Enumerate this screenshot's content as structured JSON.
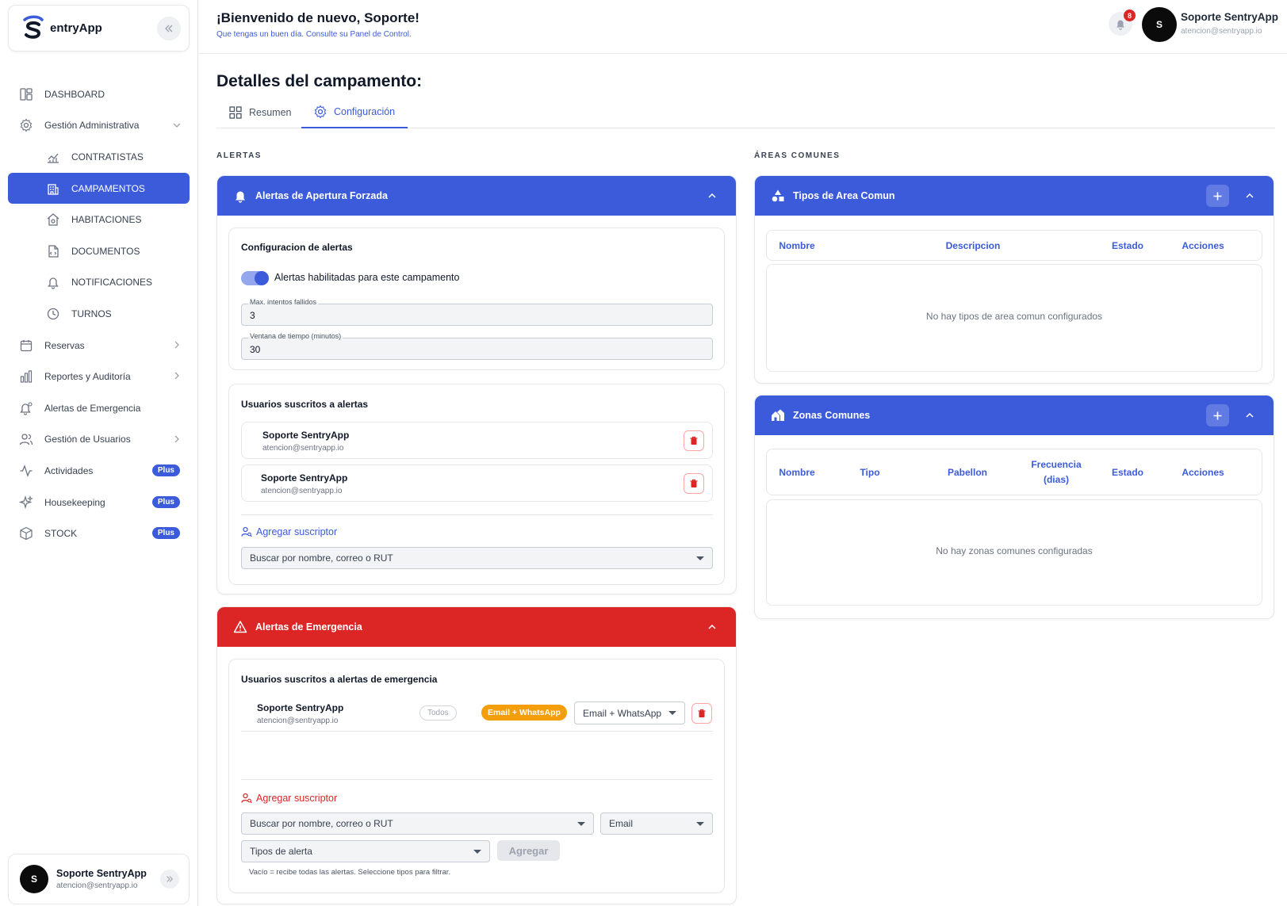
{
  "brand": {
    "logo_letter": "S",
    "name": "entryApp"
  },
  "sidebar": {
    "items": [
      {
        "label": "DASHBOARD"
      },
      {
        "label": "Gestión Administrativa"
      },
      {
        "label": "CONTRATISTAS"
      },
      {
        "label": "CAMPAMENTOS"
      },
      {
        "label": "HABITACIONES"
      },
      {
        "label": "DOCUMENTOS"
      },
      {
        "label": "NOTIFICACIONES"
      },
      {
        "label": "TURNOS"
      },
      {
        "label": "Reservas"
      },
      {
        "label": "Reportes y Auditoría"
      },
      {
        "label": "Alertas de Emergencia"
      },
      {
        "label": "Gestión de Usuarios"
      },
      {
        "label": "Actividades",
        "badge": "Plus"
      },
      {
        "label": "Housekeeping",
        "badge": "Plus"
      },
      {
        "label": "STOCK",
        "badge": "Plus"
      }
    ],
    "user": {
      "initial": "S",
      "name": "Soporte SentryApp",
      "email": "atencion@sentryapp.io"
    }
  },
  "header": {
    "welcome": "¡Bienvenido de nuevo, Soporte!",
    "subtitle": "Que tengas un buen día. Consulte su Panel de Control.",
    "notification_count": "8",
    "user": {
      "initial": "S",
      "name": "Soporte SentryApp",
      "email": "atencion@sentryapp.io"
    }
  },
  "page": {
    "title": "Detalles del campamento:",
    "tabs": [
      {
        "label": "Resumen"
      },
      {
        "label": "Configuración"
      }
    ]
  },
  "alerts": {
    "section_label": "ALERTAS",
    "forced": {
      "title": "Alertas de Apertura Forzada",
      "config_title": "Configuracion de alertas",
      "toggle_label": "Alertas habilitadas para este campamento",
      "max_attempts_label": "Max. intentos fallidos",
      "max_attempts_value": "3",
      "window_label": "Ventana de tiempo (minutos)",
      "window_value": "30",
      "subscribers_title": "Usuarios suscritos a alertas",
      "subscribers": [
        {
          "name": "Soporte SentryApp",
          "email": "atencion@sentryapp.io"
        },
        {
          "name": "Soporte SentryApp",
          "email": "atencion@sentryapp.io"
        }
      ],
      "add_label": "Agregar suscriptor",
      "search_placeholder": "Buscar por nombre, correo o RUT"
    },
    "emergency": {
      "title": "Alertas de Emergencia",
      "subscribers_title": "Usuarios suscritos a alertas de emergencia",
      "subscriber": {
        "name": "Soporte SentryApp",
        "email": "atencion@sentryapp.io",
        "scope": "Todos",
        "channel_badge": "Email + WhatsApp",
        "channel_select": "Email + WhatsApp"
      },
      "add_label": "Agregar suscriptor",
      "search_placeholder": "Buscar por nombre, correo o RUT",
      "channel_value": "Email",
      "types_placeholder": "Tipos de alerta",
      "add_button": "Agregar",
      "hint": "Vacío = recibe todas las alertas. Seleccione tipos para filtrar."
    }
  },
  "common": {
    "section_label": "ÁREAS COMUNES",
    "types": {
      "title": "Tipos de Area Comun",
      "columns": [
        "Nombre",
        "Descripcion",
        "Estado",
        "Acciones"
      ],
      "empty": "No hay tipos de area comun configurados"
    },
    "zones": {
      "title": "Zonas Comunes",
      "columns": [
        "Nombre",
        "Tipo",
        "Pabellon",
        "Frecuencia (dias)",
        "Estado",
        "Acciones"
      ],
      "empty": "No hay zonas comunes configuradas"
    }
  },
  "colors": {
    "primary": "#3b5bdb",
    "danger": "#dc2626",
    "warning": "#f59e0b"
  }
}
